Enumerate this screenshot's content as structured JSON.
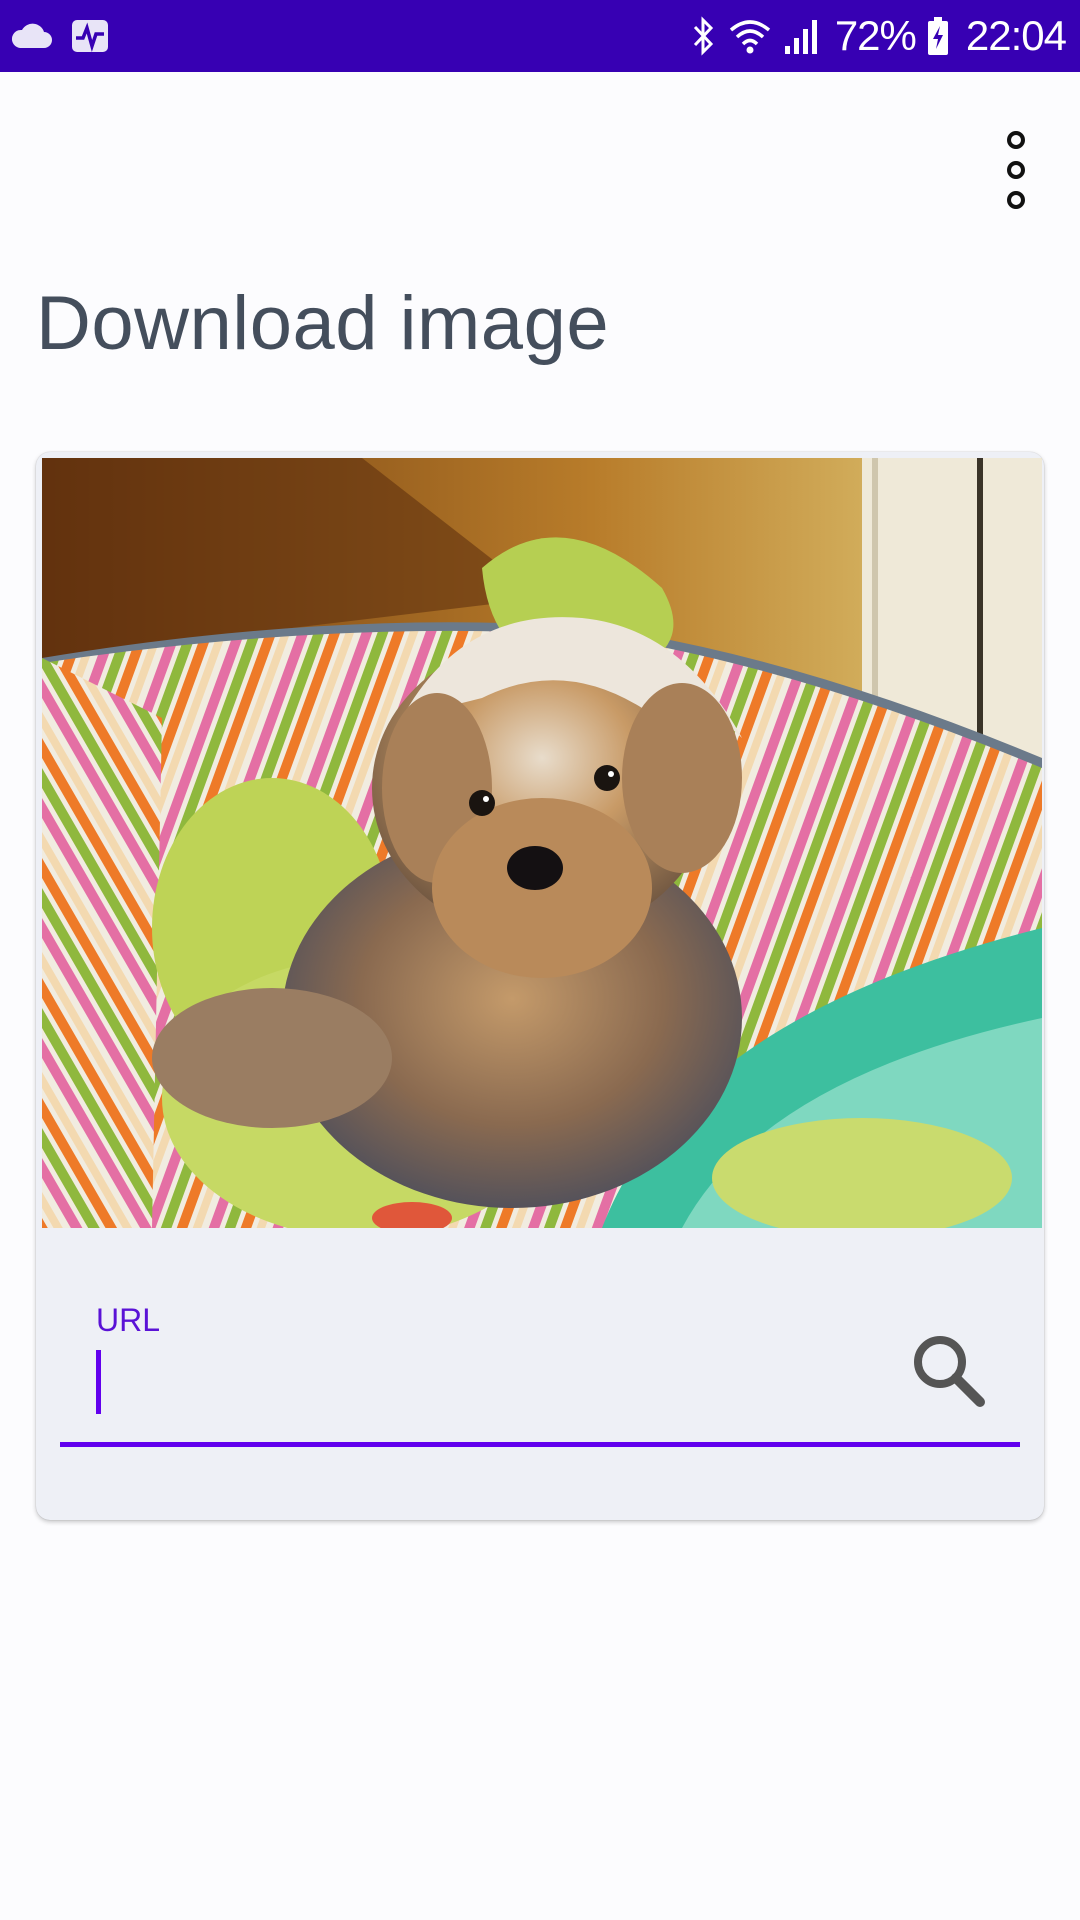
{
  "status_bar": {
    "battery": "72%",
    "time": "22:04",
    "icons": [
      "cloud-icon",
      "activity-icon",
      "bluetooth-icon",
      "wifi-icon",
      "signal-icon",
      "battery-charging-icon"
    ]
  },
  "app_bar": {
    "overflow_icon": "more-vert-icon"
  },
  "page": {
    "title": "Download image"
  },
  "card": {
    "image_subject": "yorkshire-terrier-photo",
    "url_field": {
      "label": "URL",
      "value": "",
      "placeholder": "",
      "search_icon": "search-icon"
    }
  },
  "colors": {
    "status_bar": "#3700b3",
    "accent": "#6200ee",
    "title_text": "#444e5c",
    "card_background": "#eef0f6"
  }
}
